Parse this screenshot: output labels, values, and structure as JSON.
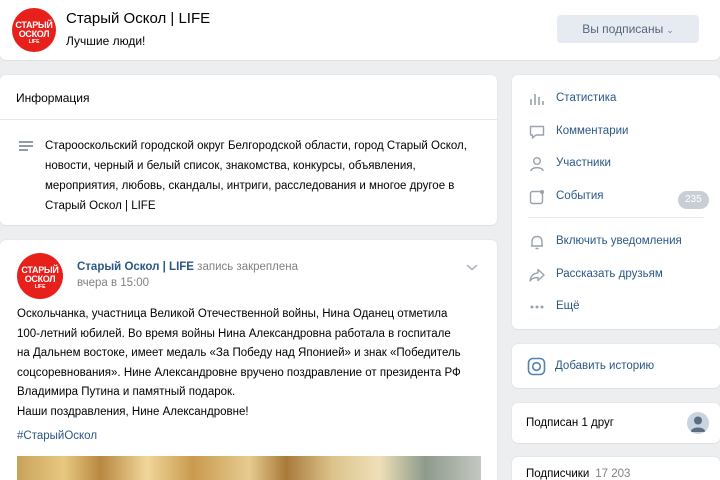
{
  "header": {
    "logo_text": [
      "СТАРЫЙ",
      "ОСКОЛ",
      "LIFE"
    ],
    "group_name": "Старый Оскол | LIFE",
    "group_status": "Лучшие люди!",
    "subscribe_button": "Вы подписаны",
    "subscribe_chevron_icon": "chevron-down-icon"
  },
  "info": {
    "title": "Информация",
    "icon": "text-lines-icon",
    "description": "Старооскольский городской округ Белгородской области, город Старый Оскол, новости, черный и белый список, знакомства, конкурсы, объявления, мероприятия, любовь, скандалы, интриги, расследования и многое другое в Старый Оскол | LIFE"
  },
  "post": {
    "author": "Старый Оскол | LIFE",
    "pinned_label": "запись закреплена",
    "time": "вчера в 15:00",
    "text_lines": [
      "Оскольчанка, участница Великой Отечественной войны, Нина Оданец отметила",
      "100-летний юбилей. Во время войны Нина Александровна работала в госпитале",
      "на Дальнем востоке, имеет медаль «За Победу над Японией» и знак «Победитель",
      "соцсоревнования». Нине Александровне вручено поздравление от президента РФ",
      "Владимира Путина и памятный подарок.",
      "Наши поздравления, Нине Александровне!"
    ],
    "hashtag": "#СтарыйОскол"
  },
  "sidebar": {
    "menu": [
      {
        "label": "Статистика",
        "icon": "bar-chart-icon"
      },
      {
        "label": "Комментарии",
        "icon": "comment-icon"
      },
      {
        "label": "Участники",
        "icon": "user-icon"
      },
      {
        "label": "События",
        "icon": "calendar-icon",
        "badge": "235"
      },
      {
        "label": "Включить уведомления",
        "icon": "bell-icon"
      },
      {
        "label": "Рассказать друзьям",
        "icon": "share-icon"
      },
      {
        "label": "Ещё",
        "icon": "more-dots-icon"
      }
    ],
    "story": {
      "label": "Добавить историю",
      "icon": "instagram-icon"
    },
    "friends": {
      "label": "Подписан 1 друг"
    },
    "subscribers": {
      "label": "Подписчики",
      "count": "17 203"
    }
  },
  "colors": {
    "background": "#edeef0",
    "brand_red": "#e8201c",
    "link_blue": "#2a5885",
    "muted_gray": "#828282",
    "button_bg": "#e5ebf1"
  }
}
